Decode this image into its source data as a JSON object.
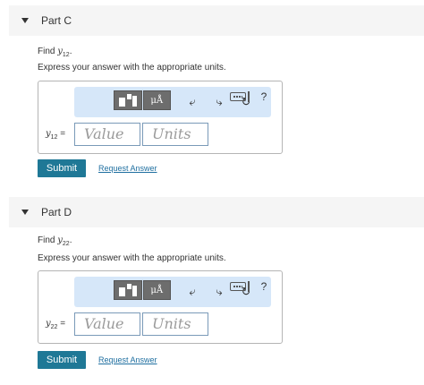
{
  "parts": [
    {
      "title": "Part C",
      "find_prefix": "Find ",
      "find_var": "y",
      "find_sub": "12",
      "find_suffix": ".",
      "instruction": "Express your answer with the appropriate units.",
      "answer_var": "y",
      "answer_sub": "12",
      "answer_eq": " =",
      "value_placeholder": "Value",
      "units_placeholder": "Units",
      "units_tool_label": "μÅ",
      "help_label": "?",
      "submit_label": "Submit",
      "request_label": "Request Answer"
    },
    {
      "title": "Part D",
      "find_prefix": "Find ",
      "find_var": "y",
      "find_sub": "22",
      "find_suffix": ".",
      "instruction": "Express your answer with the appropriate units.",
      "answer_var": "y",
      "answer_sub": "22",
      "answer_eq": " =",
      "value_placeholder": "Value",
      "units_placeholder": "Units",
      "units_tool_label": "μÅ",
      "help_label": "?",
      "submit_label": "Submit",
      "request_label": "Request Answer"
    }
  ],
  "icons": {
    "caret": "caret-down-icon",
    "templates": "templates-icon",
    "undo": "undo-icon",
    "redo": "redo-icon",
    "reset": "reset-icon",
    "keyboard": "keyboard-icon",
    "help": "help-icon"
  },
  "colors": {
    "submit_bg": "#1f7896",
    "toolbar_bg": "#d6e7f9",
    "link": "#1f6fa0",
    "header_bg": "#f5f5f5"
  }
}
